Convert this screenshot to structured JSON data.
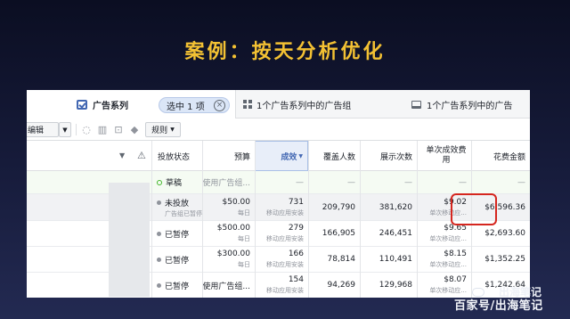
{
  "slide": {
    "title": "案例：按天分析优化"
  },
  "tabs": {
    "campaigns": {
      "label": "广告系列",
      "icon": "checkbox-icon"
    },
    "selection": {
      "label": "选中 1 项",
      "clear": "⊗"
    },
    "adsets": {
      "label": "1个广告系列中的广告组",
      "icon": "grid-icon"
    },
    "ads": {
      "label": "1个广告系列中的广告",
      "icon": "ad-icon"
    }
  },
  "toolbar": {
    "edit_label": "编辑",
    "rules_label": "规则"
  },
  "columns": {
    "status": "投放状态",
    "budget": "预算",
    "results": "成效",
    "reach": "覆盖人数",
    "impressions": "展示次数",
    "cost_per_result": "单次成效费用",
    "spend": "花费金额"
  },
  "rows": [
    {
      "status": "草稿",
      "status_sub": "",
      "budget": "使用广告组...",
      "budget_sub": "",
      "results": "—",
      "results_sub": "",
      "reach": "—",
      "impressions": "—",
      "cost": "—",
      "cost_sub": "",
      "spend": "—"
    },
    {
      "status": "未投放",
      "status_sub": "广告组已暂停",
      "budget": "$50.00",
      "budget_sub": "每日",
      "results": "731",
      "results_sub": "移动应用安装",
      "reach": "209,790",
      "impressions": "381,620",
      "cost": "$9.02",
      "cost_sub": "单次移动应...",
      "spend": "$6,596.36"
    },
    {
      "status": "已暂停",
      "status_sub": "",
      "budget": "$500.00",
      "budget_sub": "每日",
      "results": "279",
      "results_sub": "移动应用安装",
      "reach": "166,905",
      "impressions": "246,451",
      "cost": "$9.65",
      "cost_sub": "单次移动应...",
      "spend": "$2,693.60"
    },
    {
      "status": "已暂停",
      "status_sub": "",
      "budget": "$300.00",
      "budget_sub": "每日",
      "results": "166",
      "results_sub": "移动应用安装",
      "reach": "78,814",
      "impressions": "110,491",
      "cost": "$8.15",
      "cost_sub": "单次移动应...",
      "spend": "$1,352.25"
    },
    {
      "status": "已暂停",
      "status_sub": "",
      "budget": "使用广告组...",
      "budget_sub": "",
      "results": "154",
      "results_sub": "移动应用安装",
      "reach": "94,269",
      "impressions": "129,968",
      "cost": "$8.07",
      "cost_sub": "单次移动应...",
      "spend": "$1,242.64"
    }
  ],
  "watermark": {
    "line1": "出海笔记",
    "line2": "百家号/出海笔记"
  },
  "colors": {
    "title": "#f3c133",
    "accent": "#4267b2",
    "highlight_box": "#d5261f",
    "draft_dot": "#42b72a"
  }
}
